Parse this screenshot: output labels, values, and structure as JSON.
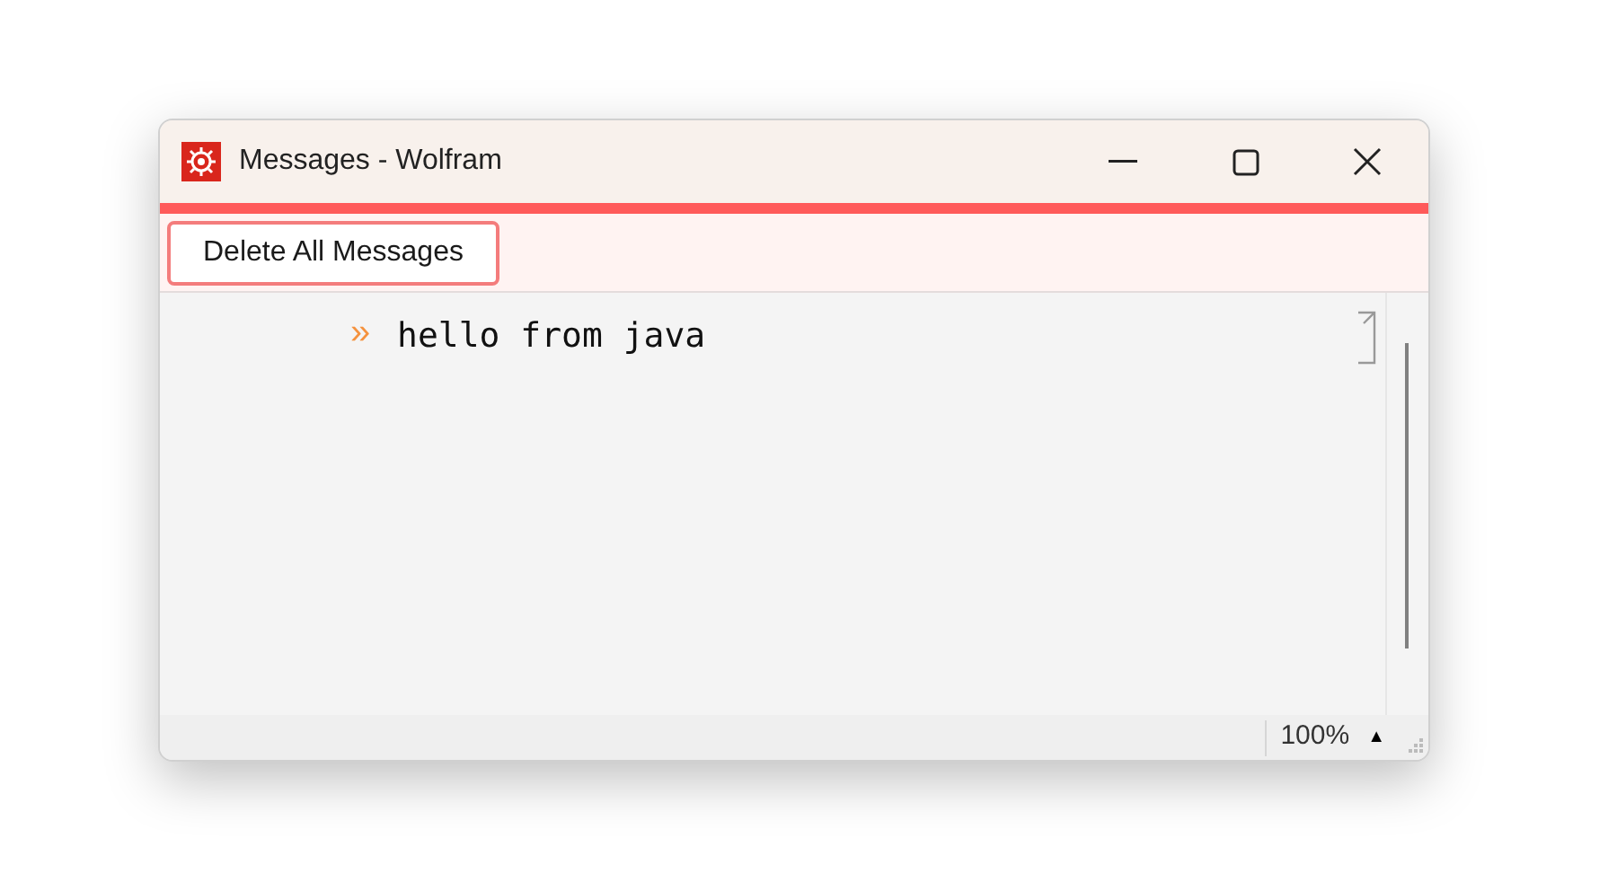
{
  "window": {
    "title": "Messages - Wolfram"
  },
  "toolbar": {
    "buttons": [
      "Delete All Messages"
    ]
  },
  "messages": [
    {
      "marker": "»",
      "text": "hello from java"
    }
  ],
  "status_bar": {
    "zoom": "100%",
    "zoom_menu": "▲"
  }
}
